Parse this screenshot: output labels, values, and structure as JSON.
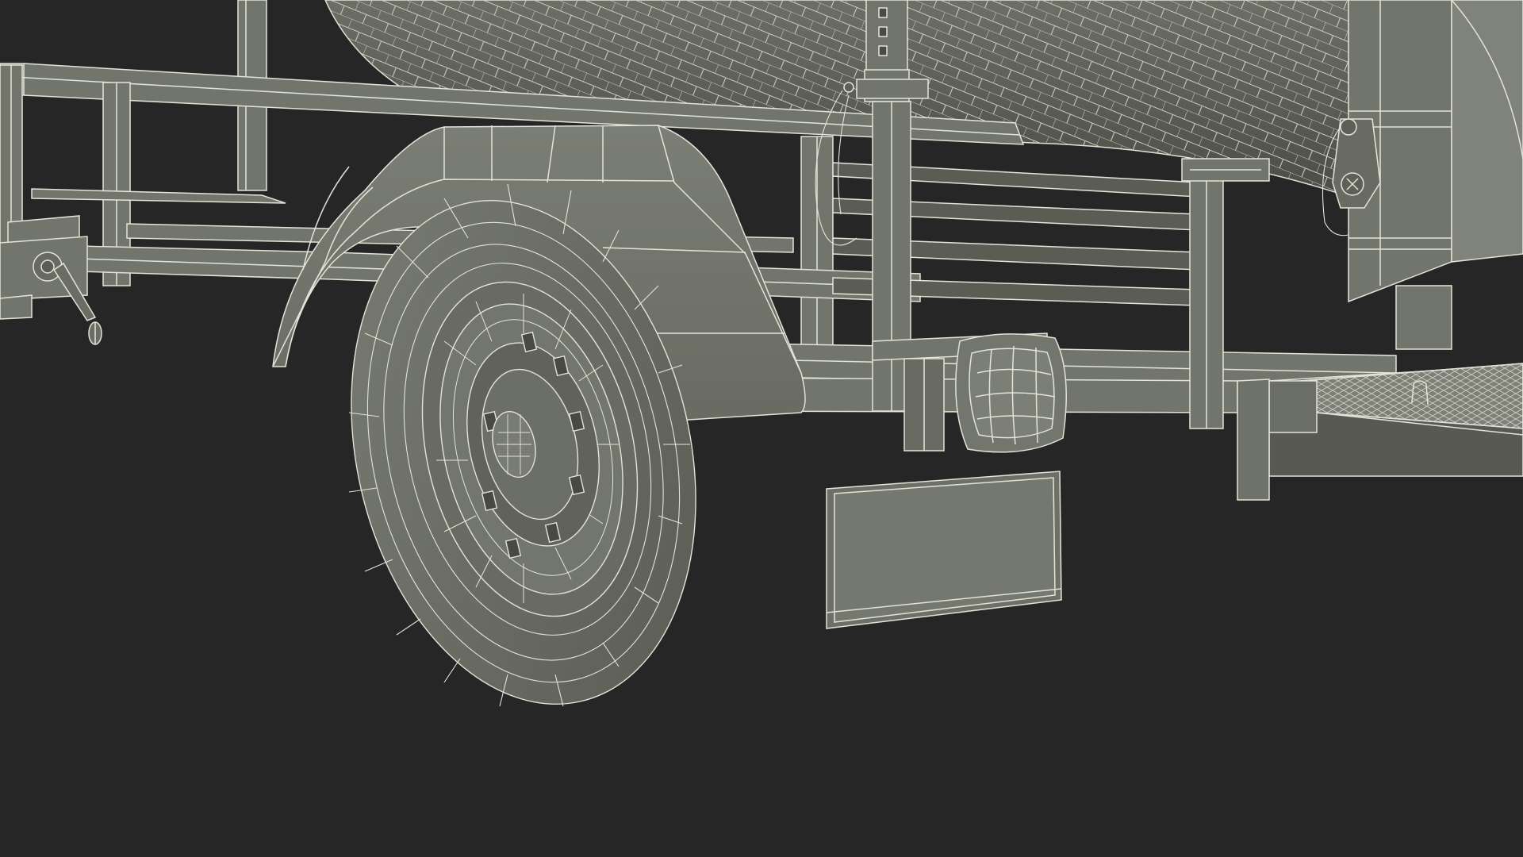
{
  "viewport": {
    "background_color": "#262626",
    "surface_color": "#70736a",
    "surface_dark_color": "#3d3e39",
    "wire_color": "#e3e4d8"
  },
  "model": {
    "subject": "trailer",
    "parts": [
      "drum-wireframe",
      "trailer-frame",
      "wheel",
      "fender",
      "jack-stand",
      "tail-light",
      "license-plate",
      "drum-cradle",
      "hitch-clamp",
      "front-deck"
    ]
  }
}
